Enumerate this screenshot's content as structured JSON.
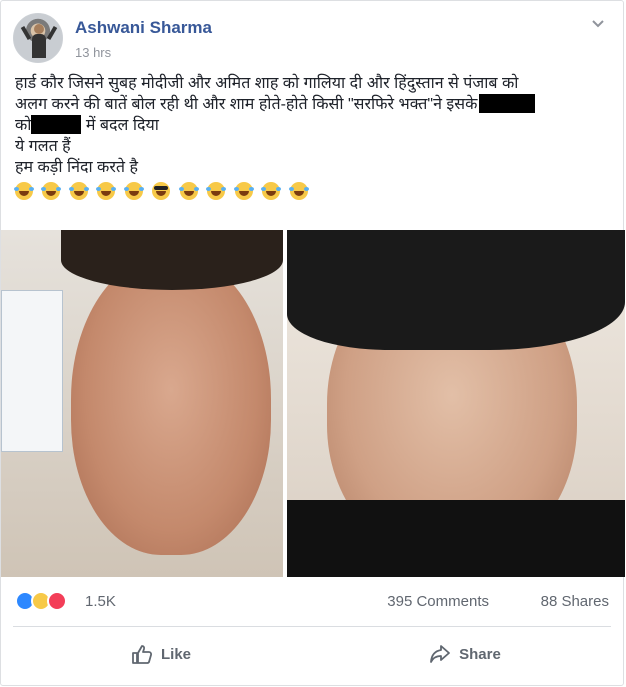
{
  "post": {
    "author": "Ashwani Sharma",
    "time": "13 hrs",
    "text_lines": [
      "हार्ड कौर जिसने सुबह मोदीजी और अमित शाह को गालिया दी और हिंदुस्तान से पंजाब को",
      "अलग करने की बातें बोल रही थी और शाम होते-होते किसी \"सरफिरे भक्त\"ने इसके",
      "को",
      "में बदल दिया",
      "ये गलत हैं",
      "हम कड़ी निंदा करते है"
    ],
    "emoji_count": 11,
    "icons": [
      "chevron-down-icon",
      "laughing-crying-emoji",
      "sunglasses-emoji",
      "like-reaction-icon",
      "haha-reaction-icon",
      "love-reaction-icon",
      "thumbs-up-icon",
      "share-arrow-icon"
    ]
  },
  "stats": {
    "reactions": "1.5K",
    "comments": "395 Comments",
    "shares": "88 Shares"
  },
  "actions": {
    "like": "Like",
    "share": "Share"
  },
  "colors": {
    "author": "#385898",
    "meta": "#90949c",
    "like_blue": "#2d88ff",
    "love_red": "#f33e58",
    "haha_yellow": "#f7c948"
  }
}
